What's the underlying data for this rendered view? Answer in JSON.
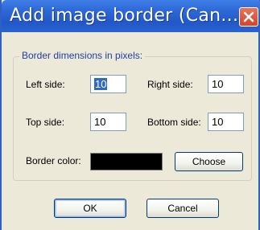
{
  "dialog": {
    "title": "Add image border (Can...",
    "close_icon": "close-icon",
    "group_label": "Border dimensions in pixels:",
    "left_side": {
      "label": "Left side:",
      "value": "10"
    },
    "right_side": {
      "label": "Right side:",
      "value": "10"
    },
    "top_side": {
      "label": "Top side:",
      "value": "10"
    },
    "bottom_side": {
      "label": "Bottom side:",
      "value": "10"
    },
    "border_color": {
      "label": "Border color:",
      "value": "#000000"
    },
    "choose_label": "Choose",
    "ok_label": "OK",
    "cancel_label": "Cancel"
  },
  "colors": {
    "title_bar": "#2f6ad9",
    "close_button": "#d2452a",
    "dialog_bg": "#ece9d8",
    "group_label": "#1f3fa8"
  }
}
